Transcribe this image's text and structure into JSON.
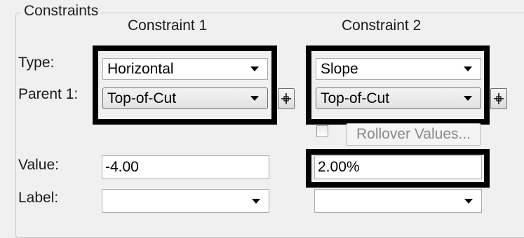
{
  "group": {
    "title": "Constraints"
  },
  "columns": {
    "c1": "Constraint 1",
    "c2": "Constraint 2"
  },
  "labels": {
    "type": "Type:",
    "parent1": "Parent 1:",
    "value": "Value:",
    "label": "Label:"
  },
  "constraint1": {
    "type": "Horizontal",
    "parent": "Top-of-Cut",
    "value": "-4.00",
    "label": ""
  },
  "constraint2": {
    "type": "Slope",
    "parent": "Top-of-Cut",
    "value": "2.00%",
    "label": "",
    "rollover_checked": false,
    "rollover_button": "Rollover Values..."
  },
  "icons": {
    "dropdown": "chevron-down-icon",
    "pick_parent": "crosshair-pick-icon"
  }
}
